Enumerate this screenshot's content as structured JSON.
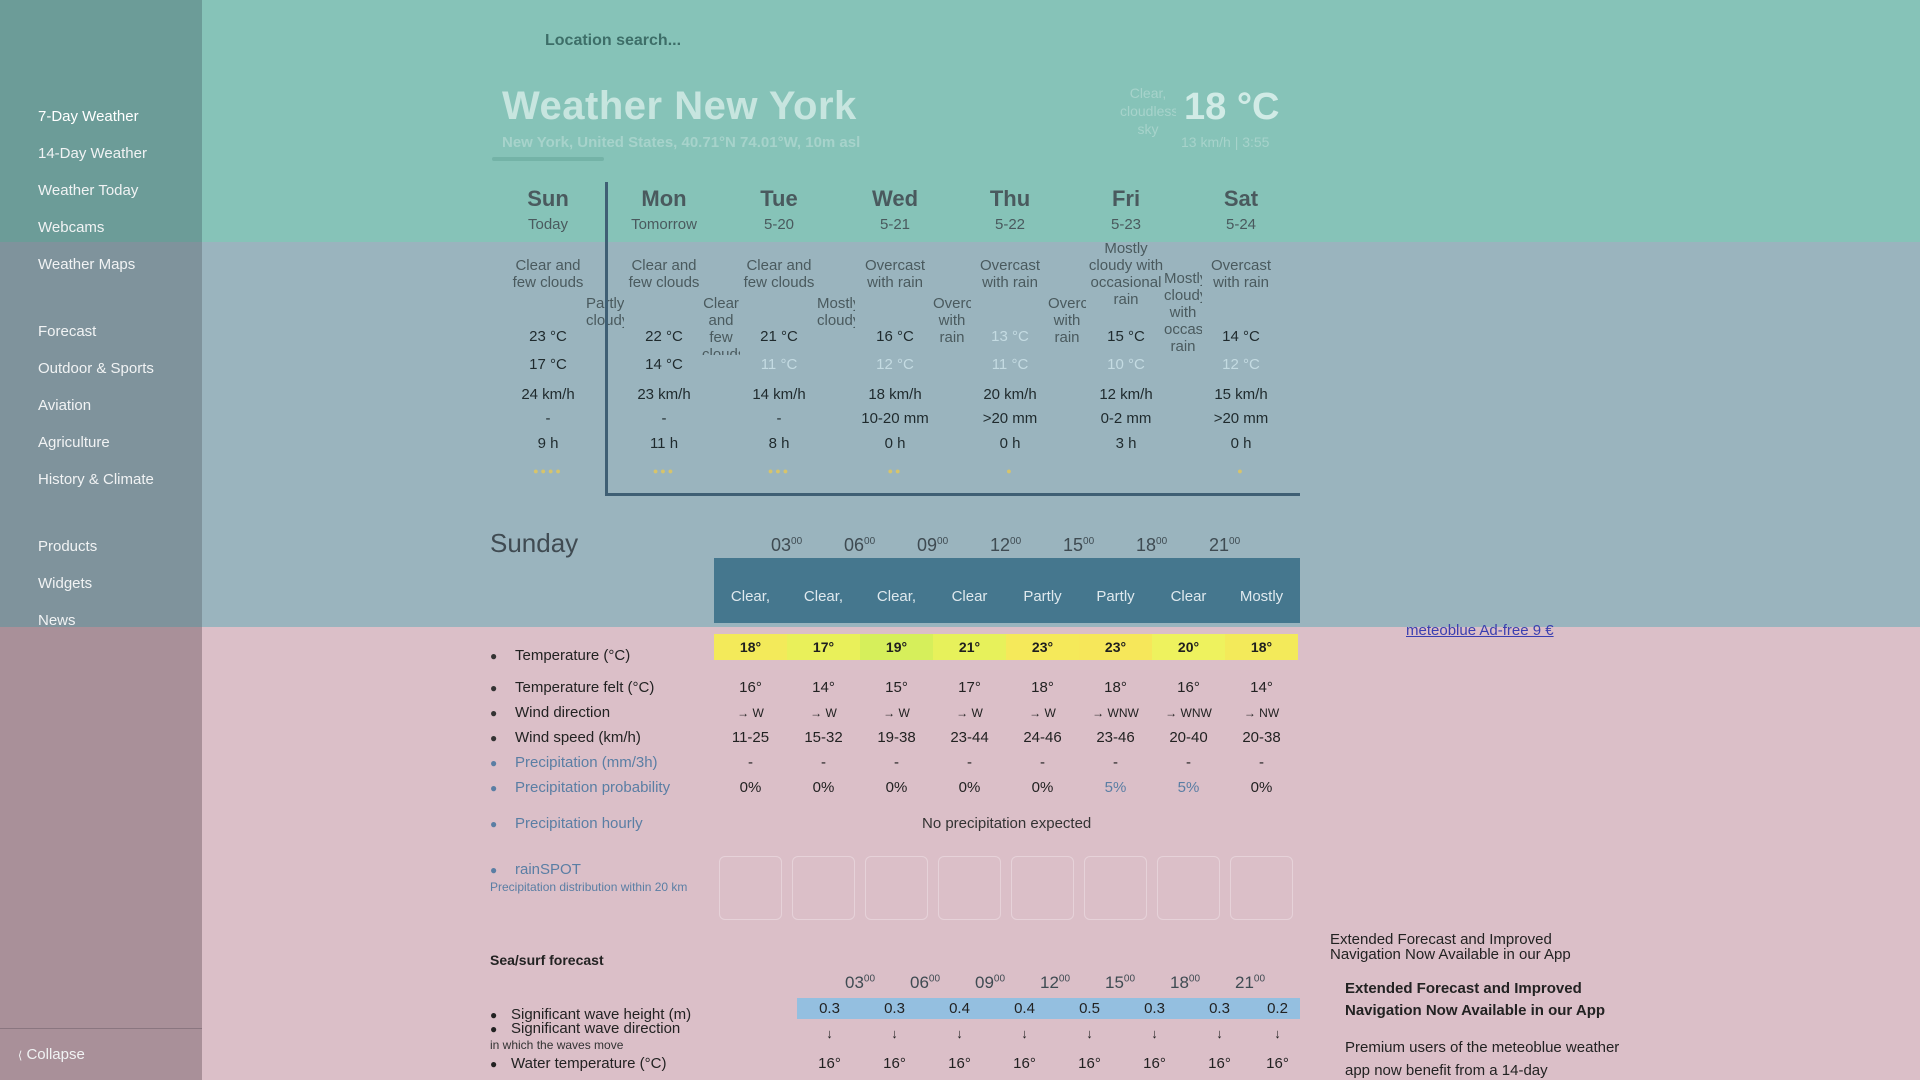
{
  "search": {
    "placeholder": "Location search..."
  },
  "sidebar": {
    "groups": [
      [
        "7-Day Weather",
        "14-Day Weather",
        "Weather Today",
        "Webcams",
        "Weather Maps"
      ],
      [
        "Forecast",
        "Outdoor & Sports",
        "Aviation",
        "Agriculture",
        "History & Climate"
      ],
      [
        "Products",
        "Widgets",
        "News"
      ]
    ],
    "collapse": "Collapse",
    "collapse_icon": "chevron-left-icon"
  },
  "header": {
    "title": "Weather New York",
    "subtitle": "New York, United States, 40.71°N 74.01°W, 10m asl",
    "current_icon_alt": "Clear, cloudless sky",
    "current_temp": "18 °C",
    "current_sub": "13 km/h | 3:55"
  },
  "days": [
    {
      "name": "Sun",
      "date": "Today",
      "icon": "Clear and few clouds",
      "icon2": "Partly cloudy",
      "max": "23 °C",
      "min": "17 °C",
      "wind": "24 km/h",
      "rain": "-",
      "sun": "9 h",
      "predict": "●●●●"
    },
    {
      "name": "Mon",
      "date": "Tomorrow",
      "icon": "Clear and few clouds",
      "icon2": "Clear and few clouds",
      "max": "22 °C",
      "min": "14 °C",
      "wind": "23 km/h",
      "rain": "-",
      "sun": "11 h",
      "predict": "●●●"
    },
    {
      "name": "Tue",
      "date": "5-20",
      "icon": "Clear and few clouds",
      "icon2": "Mostly cloudy",
      "max": "21 °C",
      "min": "11 °C",
      "wind": "14 km/h",
      "rain": "-",
      "sun": "8 h",
      "predict": "●●●"
    },
    {
      "name": "Wed",
      "date": "5-21",
      "icon": "Overcast with rain",
      "icon2": "Overcast with rain",
      "max": "16 °C",
      "min": "12 °C",
      "wind": "18 km/h",
      "rain": "10-20 mm",
      "sun": "0 h",
      "predict": "●●"
    },
    {
      "name": "Thu",
      "date": "5-22",
      "icon": "Overcast with rain",
      "icon2": "Overcast with rain",
      "max": "13 °C",
      "min": "11 °C",
      "wind": "20 km/h",
      "rain": ">20 mm",
      "sun": "0 h",
      "predict": "●"
    },
    {
      "name": "Fri",
      "date": "5-23",
      "icon": "Mostly cloudy with occasional rain",
      "icon2": "Mostly cloudy with occasional rain",
      "max": "15 °C",
      "min": "10 °C",
      "wind": "12 km/h",
      "rain": "0-2 mm",
      "sun": "3 h",
      "predict": ""
    },
    {
      "name": "Sat",
      "date": "5-24",
      "icon": "Overcast with rain",
      "icon2": "",
      "max": "14 °C",
      "min": "12 °C",
      "wind": "15 km/h",
      "rain": ">20 mm",
      "sun": "0 h",
      "predict": "●"
    }
  ],
  "sunday": {
    "title": "Sunday",
    "hours": [
      "03",
      "06",
      "09",
      "12",
      "15",
      "18",
      "21"
    ],
    "hour_icons": [
      "Clear,",
      "Clear,",
      "Clear,",
      "Clear",
      "Partly",
      "Partly",
      "Clear",
      "Mostly"
    ],
    "rows": {
      "temperature": {
        "label": "Temperature (°C)",
        "values": [
          "18°",
          "17°",
          "19°",
          "21°",
          "23°",
          "23°",
          "20°",
          "18°"
        ],
        "colors": [
          "#f3ea5a",
          "#e9f05a",
          "#d6ef5b",
          "#e7f15b",
          "#f5e95a",
          "#f6e75a",
          "#eef25e",
          "#f3ea5a"
        ]
      },
      "felt": {
        "label": "Temperature felt (°C)",
        "values": [
          "16°",
          "14°",
          "15°",
          "17°",
          "18°",
          "18°",
          "16°",
          "14°"
        ]
      },
      "wind_dir": {
        "label": "Wind direction",
        "values": [
          "W",
          "W",
          "W",
          "W",
          "W",
          "WNW",
          "WNW",
          "NW"
        ]
      },
      "wind_speed": {
        "label": "Wind speed (km/h)",
        "values": [
          "11-25",
          "15-32",
          "19-38",
          "23-44",
          "24-46",
          "23-46",
          "20-40",
          "20-38"
        ]
      },
      "precip": {
        "label": "Precipitation (mm/3h)",
        "values": [
          "-",
          "-",
          "-",
          "-",
          "-",
          "-",
          "-",
          "-"
        ]
      },
      "precip_prob": {
        "label": "Precipitation probability",
        "values": [
          "0%",
          "0%",
          "0%",
          "0%",
          "0%",
          "5%",
          "5%",
          "0%"
        ]
      }
    },
    "precip_hourly": {
      "label": "Precipitation hourly",
      "text": "No precipitation expected"
    },
    "rainspot": {
      "label": "rainSPOT",
      "sub": "Precipitation distribution within 20 km"
    }
  },
  "sea": {
    "title": "Sea/surf forecast",
    "hours": [
      "03",
      "06",
      "09",
      "12",
      "15",
      "18",
      "21"
    ],
    "wave_height": {
      "label": "Significant wave height (m)",
      "values": [
        "0.3",
        "0.3",
        "0.4",
        "0.4",
        "0.5",
        "0.3",
        "0.3",
        "0.2"
      ]
    },
    "wave_dir": {
      "label": "Significant wave direction",
      "note": "in which the waves move"
    },
    "water_temp": {
      "label": "Water temperature (°C)",
      "values": [
        "16°",
        "16°",
        "16°",
        "16°",
        "16°",
        "16°",
        "16°",
        "16°"
      ]
    }
  },
  "ad": {
    "link": "meteoblue Ad-free 9 €"
  },
  "promo": {
    "image_alt": "Extended Forecast and Improved Navigation Now Available in our App",
    "title": "Extended Forecast and Improved Navigation Now Available in our App",
    "body": "Premium users of the meteoblue weather app now benefit from a 14-day"
  }
}
